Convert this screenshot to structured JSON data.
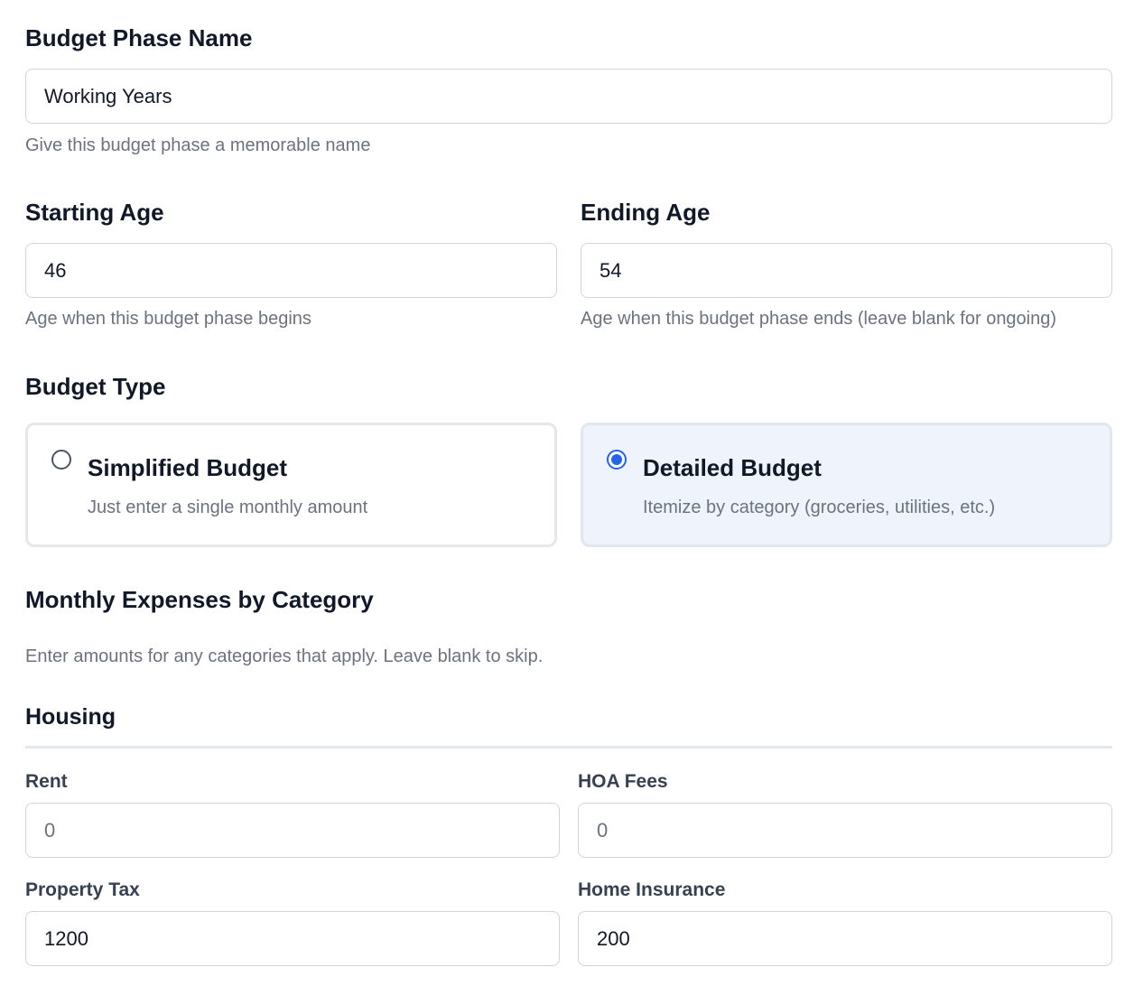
{
  "phase_name": {
    "label": "Budget Phase Name",
    "value": "Working Years",
    "help": "Give this budget phase a memorable name"
  },
  "starting_age": {
    "label": "Starting Age",
    "value": "46",
    "help": "Age when this budget phase begins"
  },
  "ending_age": {
    "label": "Ending Age",
    "value": "54",
    "help": "Age when this budget phase ends (leave blank for ongoing)"
  },
  "budget_type": {
    "label": "Budget Type",
    "options": [
      {
        "title": "Simplified Budget",
        "description": "Just enter a single monthly amount",
        "selected": false
      },
      {
        "title": "Detailed Budget",
        "description": "Itemize by category (groceries, utilities, etc.)",
        "selected": true
      }
    ]
  },
  "monthly_expenses": {
    "heading": "Monthly Expenses by Category",
    "help": "Enter amounts for any categories that apply. Leave blank to skip."
  },
  "housing": {
    "heading": "Housing",
    "rent": {
      "label": "Rent",
      "value": "",
      "placeholder": "0"
    },
    "hoa_fees": {
      "label": "HOA Fees",
      "value": "",
      "placeholder": "0"
    },
    "property_tax": {
      "label": "Property Tax",
      "value": "1200"
    },
    "home_insurance": {
      "label": "Home Insurance",
      "value": "200"
    }
  },
  "colors": {
    "accent": "#2563eb",
    "selected_card_bg": "#eff4fc",
    "help_text": "#6b7280",
    "border": "#d1d5db"
  }
}
